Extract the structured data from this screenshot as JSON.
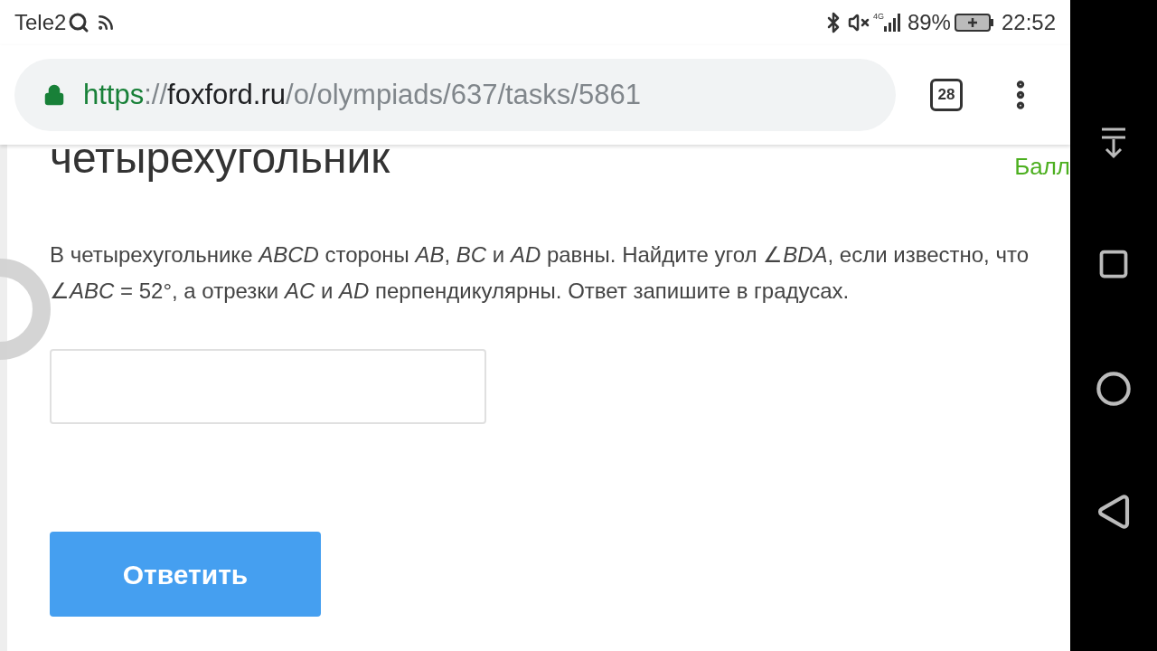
{
  "status_bar": {
    "carrier": "Tele2",
    "network": "4G",
    "battery": "89%",
    "time": "22:52"
  },
  "browser": {
    "url": {
      "scheme": "https",
      "separator": "://",
      "host": "foxford.ru",
      "path": "/o/olympiads/637/tasks/5861"
    },
    "tab_count": "28"
  },
  "page": {
    "heading": "четырехугольник",
    "score_label": "Балл",
    "task": "В четырехугольнике *ABCD* стороны *AB*, *BC* и *AD* равны. Найдите угол ∠*BDA*, если известно, что ∠*ABC* = 52°, а отрезки *AC* и *AD* перпендикулярны. Ответ запишите в градусах.",
    "submit": "Ответить"
  }
}
